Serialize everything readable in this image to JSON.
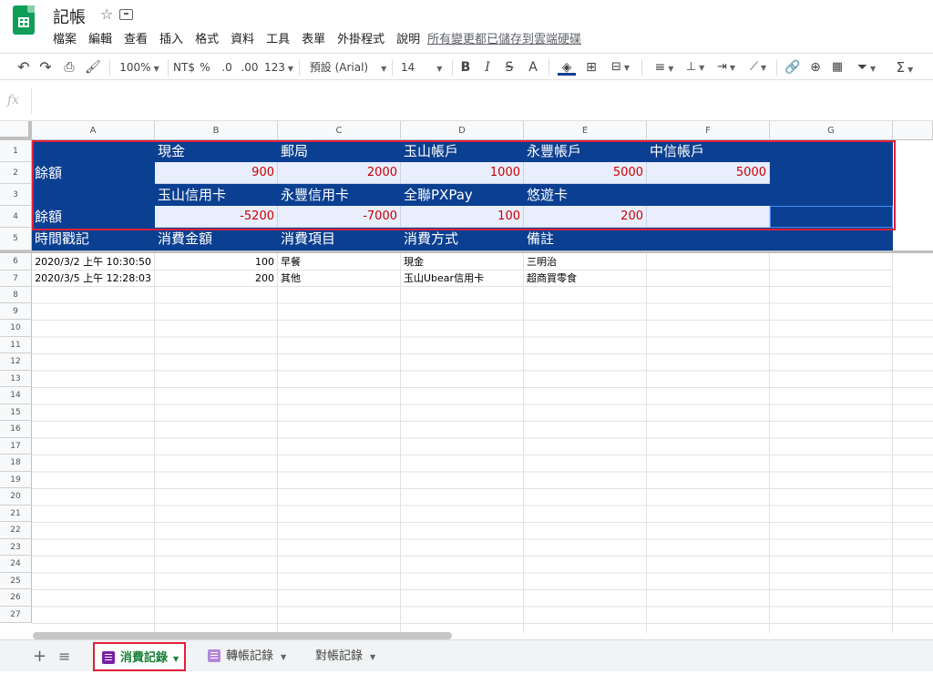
{
  "doc": {
    "title": "記帳",
    "menu": [
      "檔案",
      "編輯",
      "查看",
      "插入",
      "格式",
      "資料",
      "工具",
      "表單",
      "外掛程式",
      "說明"
    ],
    "save_status": "所有變更都已儲存到雲端硬碟"
  },
  "toolbar": {
    "zoom": "100%",
    "currency": "NT$",
    "percent": "%",
    "dec_decrease": ".0",
    "dec_increase": ".00",
    "number_format": "123",
    "font": "預設 (Arial)",
    "font_size": "14",
    "bold": "B",
    "italic": "I",
    "strike": "S",
    "text_color": "A"
  },
  "formula_bar": {
    "fx": "fx",
    "value": ""
  },
  "columns": [
    "A",
    "B",
    "C",
    "D",
    "E",
    "F",
    "G"
  ],
  "rows": [
    "1",
    "2",
    "3",
    "4",
    "5",
    "6",
    "7",
    "8",
    "9",
    "10",
    "11",
    "12",
    "13",
    "14",
    "15",
    "16",
    "17",
    "18",
    "19",
    "20",
    "21",
    "22",
    "23",
    "24",
    "25",
    "26",
    "27"
  ],
  "summary": {
    "row1": [
      "",
      "現金",
      "郵局",
      "玉山帳戶",
      "永豐帳戶",
      "中信帳戶",
      ""
    ],
    "row2": [
      "餘額",
      "900",
      "2000",
      "1000",
      "5000",
      "5000",
      ""
    ],
    "row3": [
      "",
      "玉山信用卡",
      "永豐信用卡",
      "全聯PXPay",
      "悠遊卡",
      "",
      ""
    ],
    "row4": [
      "餘額",
      "-5200",
      "-7000",
      "100",
      "200",
      "",
      ""
    ],
    "row5": [
      "時間戳記",
      "消費金額",
      "消費項目",
      "消費方式",
      "備註",
      "",
      ""
    ]
  },
  "records": [
    [
      "2020/3/2 上午 10:30:50",
      "100",
      "早餐",
      "現金",
      "三明治",
      "",
      ""
    ],
    [
      "2020/3/5 上午 12:28:03",
      "200",
      "其他",
      "玉山Ubear信用卡",
      "超商買零食",
      "",
      ""
    ]
  ],
  "sheets": [
    "消費記錄",
    "轉帳記錄",
    "對帳記錄"
  ],
  "colors": {
    "header_bg": "#0b3f91",
    "value_bg": "#e8eefc",
    "negative": "#cc0000",
    "highlight": "#e0203a",
    "active_tab": "#188038"
  }
}
